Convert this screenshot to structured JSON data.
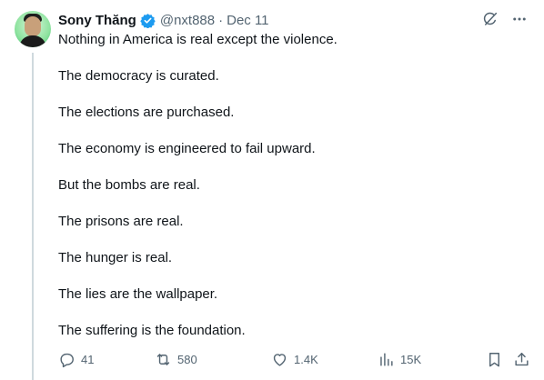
{
  "author": {
    "name": "Sony Thăng",
    "handle": "@nxt888",
    "separator": "·",
    "date": "Dec 11",
    "verified": true
  },
  "header_icons": [
    "grok-icon",
    "more-icon"
  ],
  "post": {
    "lines": [
      "Nothing in America is real except the violence.",
      "The democracy is curated.",
      "The elections are purchased.",
      "The economy is engineered to fail upward.",
      "But the bombs are real.",
      "The prisons are real.",
      "The hunger is real.",
      "The lies are the wallpaper.",
      "The suffering is the foundation."
    ]
  },
  "actions": {
    "replies": "41",
    "reposts": "580",
    "likes": "1.4K",
    "views": "15K"
  },
  "colors": {
    "text": "#0f1419",
    "secondary": "#536471",
    "verified": "#1d9bf0",
    "thread_line": "#cfd9de"
  }
}
